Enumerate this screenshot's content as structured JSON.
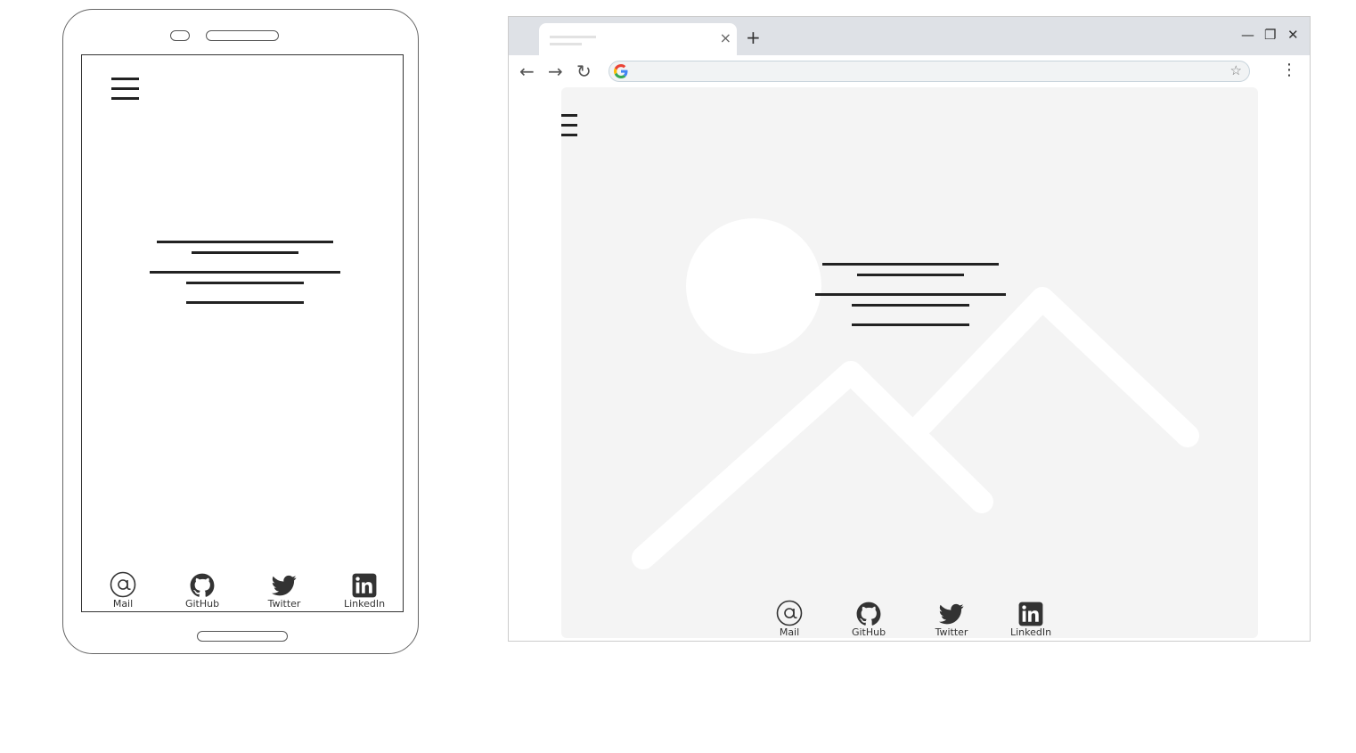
{
  "mobile": {
    "social": [
      {
        "label": "Mail",
        "icon": "at-icon"
      },
      {
        "label": "GitHub",
        "icon": "github-icon"
      },
      {
        "label": "Twitter",
        "icon": "twitter-icon"
      },
      {
        "label": "LinkedIn",
        "icon": "linkedin-icon"
      }
    ]
  },
  "desktop": {
    "omnibox_value": "",
    "social": [
      {
        "label": "Mail",
        "icon": "at-icon"
      },
      {
        "label": "GitHub",
        "icon": "github-icon"
      },
      {
        "label": "Twitter",
        "icon": "twitter-icon"
      },
      {
        "label": "LinkedIn",
        "icon": "linkedin-icon"
      }
    ]
  },
  "icons": {
    "tab_close": "×",
    "new_tab": "+",
    "back": "←",
    "forward": "→",
    "reload": "↻",
    "bookmark": "☆",
    "menu": "⋮",
    "minimize": "—",
    "restore": "❐",
    "close": "✕"
  },
  "colors": {
    "line": "#222222",
    "placeholder_bg": "#f4f4f4",
    "tabbar_bg": "#dee1e6"
  }
}
